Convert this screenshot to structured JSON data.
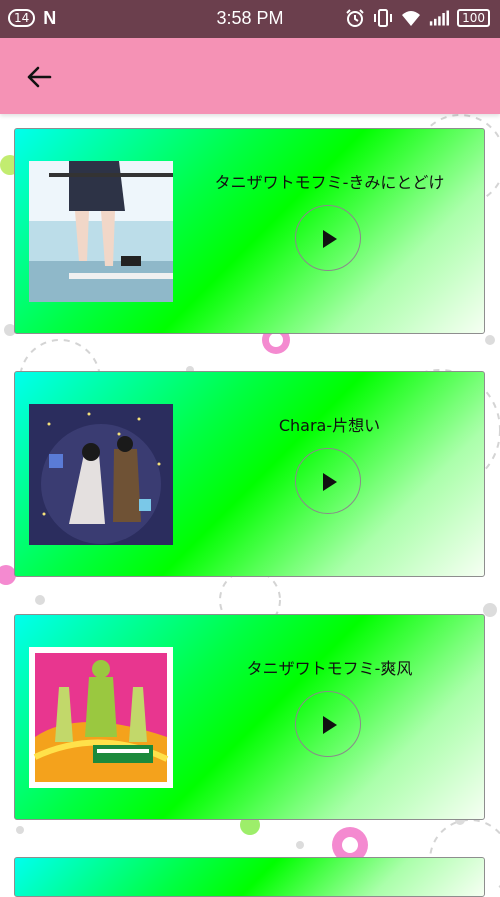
{
  "status_bar": {
    "notification_count": "14",
    "app_icon": "N",
    "time": "3:58 PM",
    "battery": "100",
    "icons": [
      "alarm-icon",
      "vibrate-icon",
      "wifi-icon",
      "signal-icon"
    ]
  },
  "app_bar": {
    "back_icon": "arrow-left-icon",
    "color": "#f592b5"
  },
  "songs": [
    {
      "title": "タニザワトモフミ-きみにとどけ",
      "cover": "schoolgirl-cover"
    },
    {
      "title": "Chara-片想い",
      "cover": "anime-couple-cover"
    },
    {
      "title": "タニザワトモフミ-爽风",
      "cover": "psychedelic-cover"
    }
  ],
  "colors": {
    "status_bar": "#6b3f4d",
    "card_gradient": [
      "#00ffee",
      "#00ff00",
      "#f6fff3"
    ]
  }
}
